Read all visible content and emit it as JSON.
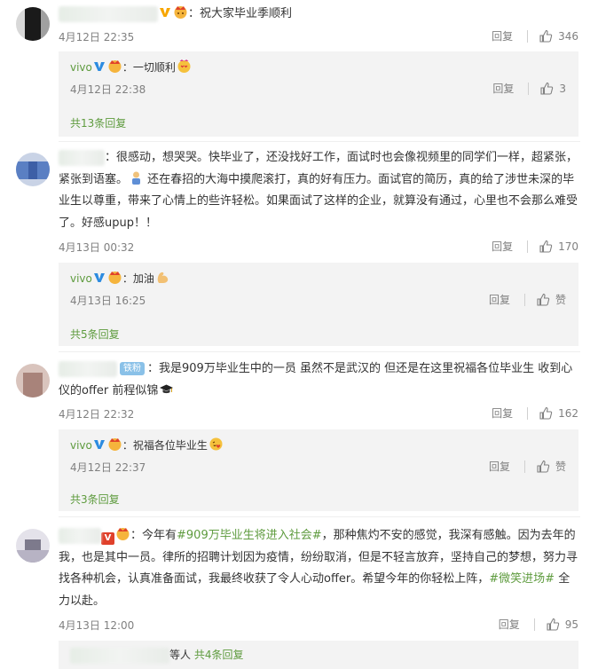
{
  "icons": {
    "like": "thumbs-up-icon",
    "verified": "vivo-verified-v-icon",
    "crown": "crown-emoji-icon"
  },
  "colors": {
    "link_green": "#5e9b3e",
    "username_orange": "#eb7350",
    "meta_gray": "#808080",
    "reply_bg": "#f3f3f3"
  },
  "comments": [
    {
      "text": "：祝大家毕业季顺利",
      "time": "4月12日 22:35",
      "reply_label": "回复",
      "likes": "346",
      "sub_reply": {
        "author": "vivo",
        "text": "：一切顺利",
        "time": "4月12日 22:38",
        "reply_label": "回复",
        "likes": "3"
      },
      "more_link": "共13条回复"
    },
    {
      "text": "：很感动，想哭哭。快毕业了，还没找好工作，面试时也会像视频里的同学们一样，超紧张，紧张到语塞。",
      "text_after_emoji": "还在春招的大海中摸爬滚打，真的好有压力。面试官的简历，真的给了涉世未深的毕业生以尊重，带来了心情上的些许轻松。如果面试了这样的企业，就算没有通过，心里也不会那么难受了。好感upup！！",
      "time": "4月13日 00:32",
      "reply_label": "回复",
      "likes": "170",
      "sub_reply": {
        "author": "vivo",
        "text": "：加油",
        "time": "4月13日 16:25",
        "reply_label": "回复",
        "likes": "赞"
      },
      "more_link": "共5条回复"
    },
    {
      "fan_badge": "铁粉",
      "text": "：我是909万毕业生中的一员 虽然不是武汉的 但还是在这里祝福各位毕业生 收到心仪的offer 前程似锦",
      "time": "4月12日 22:32",
      "reply_label": "回复",
      "likes": "162",
      "sub_reply": {
        "author": "vivo",
        "text": "：祝福各位毕业生",
        "time": "4月12日 22:37",
        "reply_label": "回复",
        "likes": "赞"
      },
      "more_link": "共3条回复"
    },
    {
      "text_prefix": "：今年有",
      "topic1": "#909万毕业生将进入社会#",
      "text_mid": "，那种焦灼不安的感觉，我深有感触。因为去年的我，也是其中一员。律所的招聘计划因为疫情，纷纷取消，但是不轻言放弃，坚持自己的梦想，努力寻找各种机会，认真准备面试，我最终收获了令人心动offer。希望今年的你轻松上阵，",
      "topic2": "#微笑进场#",
      "text_suffix": " 全力以赴。",
      "time": "4月13日 12:00",
      "reply_label": "回复",
      "likes": "95",
      "others_label": "等人",
      "more_link": "共4条回复"
    }
  ]
}
